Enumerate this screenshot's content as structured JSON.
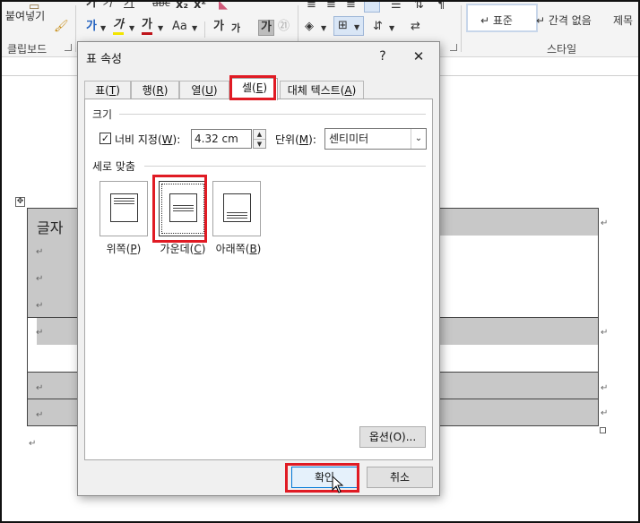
{
  "ribbon": {
    "paste_label": "붙여넣기",
    "clipboard_group": "클립보드",
    "style_group": "스타일",
    "font_tools": [
      "가",
      "가",
      "가",
      "abc",
      "x₂",
      "x²"
    ],
    "color_tools": [
      "가",
      "가",
      "가",
      "Aa"
    ],
    "size_tools": [
      "가",
      "가",
      "가",
      "㉑"
    ],
    "styles": [
      "↵ 표준",
      "↵ 간격 없음",
      "제목"
    ]
  },
  "document": {
    "cell_text": "글자",
    "para_mark": "↵"
  },
  "dialog": {
    "title": "표 속성",
    "help": "?",
    "close": "✕",
    "tabs": [
      {
        "label": "표",
        "key": "T"
      },
      {
        "label": "행",
        "key": "R"
      },
      {
        "label": "열",
        "key": "U"
      },
      {
        "label": "셀",
        "key": "E"
      },
      {
        "label": "대체 텍스트",
        "key": "A"
      }
    ],
    "size_section": "크기",
    "width_checkbox_label": "너비 지정",
    "width_key": "W",
    "width_value": "4.32 cm",
    "unit_label": "단위",
    "unit_key": "M",
    "unit_value": "센티미터",
    "valign_section": "세로 맞춤",
    "valign_options": [
      {
        "label": "위쪽",
        "key": "P"
      },
      {
        "label": "가운데",
        "key": "C"
      },
      {
        "label": "아래쪽",
        "key": "B"
      }
    ],
    "options_button": "옵션(O)...",
    "ok_button": "확인",
    "cancel_button": "취소"
  },
  "colors": {
    "highlight": "#e01b24",
    "cell_shade": "#c8c8c8",
    "accent": "#0078d7"
  }
}
